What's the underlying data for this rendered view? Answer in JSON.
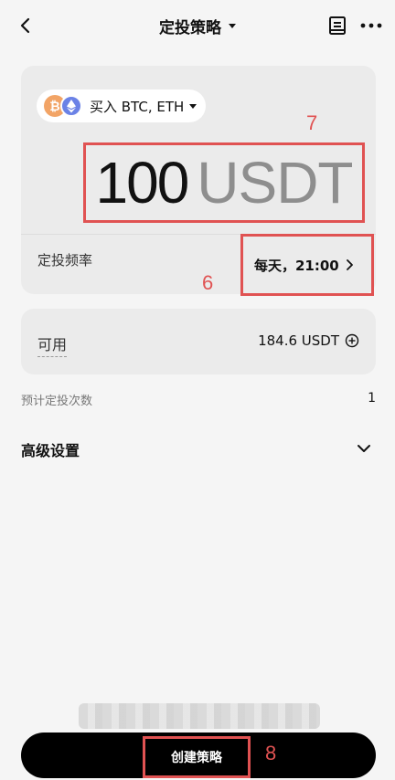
{
  "header": {
    "title": "定投策略",
    "back_icon": "chevron-left-icon",
    "book_icon": "book-icon",
    "more_icon": "more-horizontal-icon"
  },
  "buy": {
    "label": "买入 BTC, ETH",
    "coins": [
      "BTC",
      "ETH"
    ],
    "amount": "100",
    "currency": "USDT"
  },
  "frequency": {
    "label": "定投频率",
    "value": "每天，21:00"
  },
  "available": {
    "label": "可用",
    "value": "184.6 USDT"
  },
  "estimate": {
    "label": "预计定投次数",
    "value": "1"
  },
  "advanced": {
    "label": "高级设置"
  },
  "cta": {
    "label": "创建策略"
  },
  "annotations": {
    "amount": "7",
    "frequency": "6",
    "cta": "8"
  },
  "colors": {
    "highlight_border": "#e05252",
    "btc": "#f2a466",
    "eth": "#6b82e6",
    "button_bg": "#000000"
  }
}
